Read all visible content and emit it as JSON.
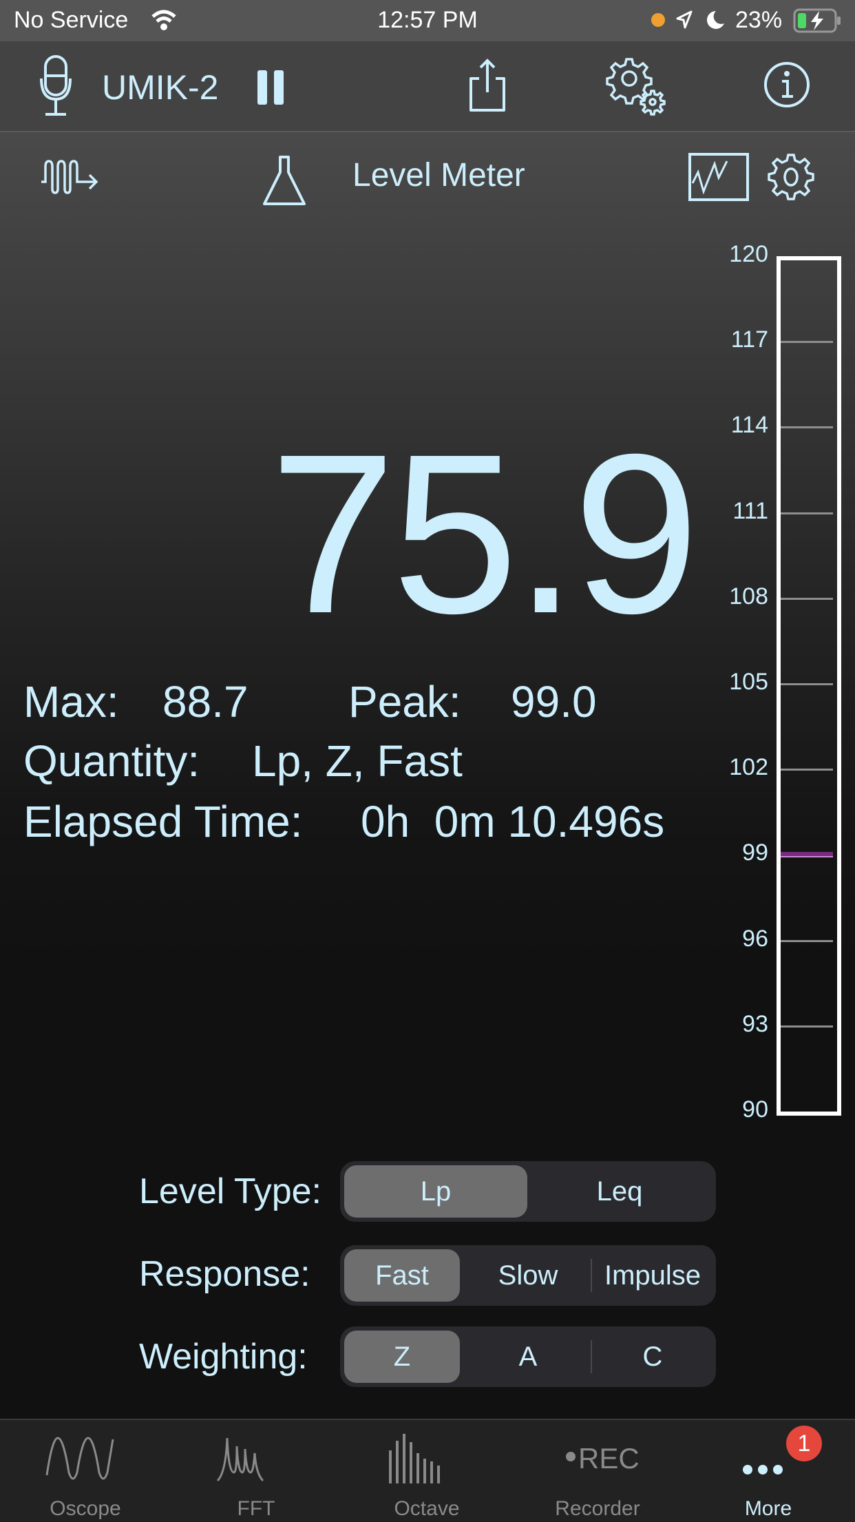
{
  "status_bar": {
    "carrier": "No Service",
    "time": "12:57 PM",
    "battery_percent": "23%",
    "icons": [
      "wifi-icon",
      "orange-dot-icon",
      "location-arrow-icon",
      "moon-icon",
      "battery-charging-icon"
    ]
  },
  "toolbar": {
    "device_name": "UMIK-2",
    "icons": [
      "microphone-icon",
      "pause-icon",
      "share-icon",
      "settings-gears-icon",
      "info-icon"
    ]
  },
  "subheader": {
    "title": "Level Meter",
    "icons": [
      "signal-generator-icon",
      "flask-icon",
      "history-graph-icon",
      "gear-icon"
    ]
  },
  "readout": {
    "value": "75.9"
  },
  "info": {
    "max_label": "Max:",
    "max_value": "88.7",
    "peak_label": "Peak:",
    "peak_value": "99.0",
    "quantity_label": "Quantity:",
    "quantity_value": "Lp, Z, Fast",
    "elapsed_label": "Elapsed Time:",
    "elapsed_value": "0h  0m 10.496s"
  },
  "meter": {
    "min": 90,
    "max": 120,
    "ticks": [
      "120",
      "117",
      "114",
      "111",
      "108",
      "105",
      "102",
      "99",
      "96",
      "93",
      "90"
    ],
    "peak_marker": 99.0,
    "peak_marker_color": "#7a2a82"
  },
  "controls": {
    "level_type": {
      "label": "Level Type:",
      "options": [
        "Lp",
        "Leq"
      ],
      "selected": "Lp"
    },
    "response": {
      "label": "Response:",
      "options": [
        "Fast",
        "Slow",
        "Impulse"
      ],
      "selected": "Fast"
    },
    "weighting": {
      "label": "Weighting:",
      "options": [
        "Z",
        "A",
        "C"
      ],
      "selected": "Z"
    }
  },
  "tabbar": {
    "tabs": [
      {
        "label": "Oscope",
        "icon": "oscilloscope-wave-icon"
      },
      {
        "label": "FFT",
        "icon": "fft-peaks-icon"
      },
      {
        "label": "Octave",
        "icon": "octave-bars-icon"
      },
      {
        "label": "Recorder",
        "icon": "rec-icon",
        "icon_text": "REC"
      },
      {
        "label": "More",
        "icon": "more-dots-icon",
        "active": true
      }
    ],
    "badge": "1"
  },
  "colors": {
    "accent": "#cdeefc",
    "badge": "#e5473c",
    "segment_selected": "#6e6e6e"
  }
}
